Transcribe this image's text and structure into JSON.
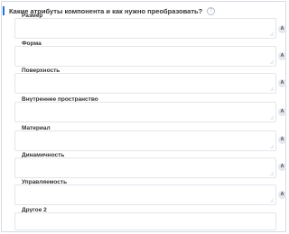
{
  "question": {
    "title": "Какие атрибуты компонента и как нужно преобразовать?",
    "help_symbol": "?"
  },
  "fields": [
    {
      "label": "Размер",
      "button": "A"
    },
    {
      "label": "Форма",
      "button": "A"
    },
    {
      "label": "Поверхность",
      "button": "A"
    },
    {
      "label": "Внутреннее пространство",
      "button": "A"
    },
    {
      "label": "Материал",
      "button": "A"
    },
    {
      "label": "Динамичность",
      "button": "A"
    },
    {
      "label": "Управляемость",
      "button": "A"
    },
    {
      "label": "Другое 2",
      "button": ""
    }
  ],
  "colors": {
    "accent": "#1e73e8",
    "border": "#e2e5ea",
    "button_bg": "#e4e7ec"
  }
}
